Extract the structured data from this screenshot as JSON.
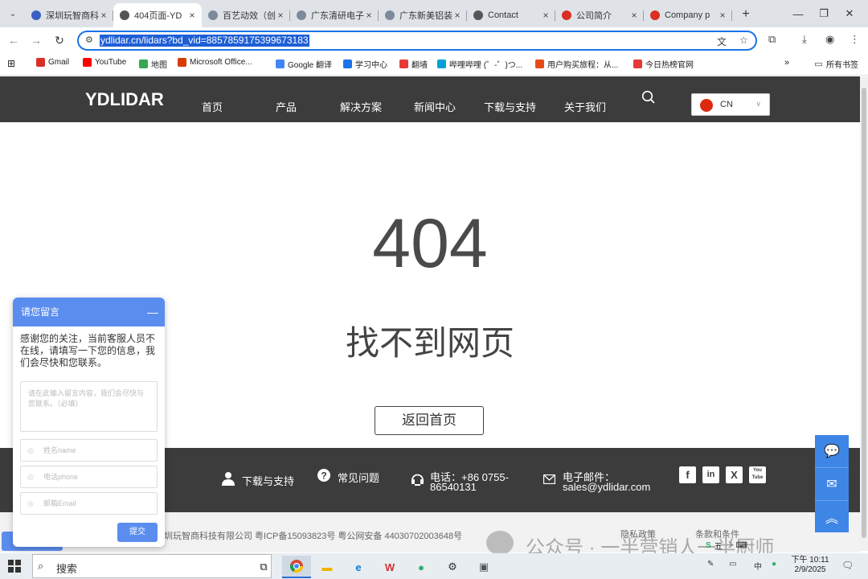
{
  "browser": {
    "tabs": [
      {
        "title": "深圳玩智商科",
        "favicon_color": "#3b5fc4",
        "active": false
      },
      {
        "title": "404页面-YD",
        "favicon_color": "#555555",
        "active": true
      },
      {
        "title": "百艺动效（创",
        "favicon_color": "#7d8a9c",
        "active": false
      },
      {
        "title": "广东清研电子",
        "favicon_color": "#7d8a9c",
        "active": false
      },
      {
        "title": "广东新美铝装",
        "favicon_color": "#7d8a9c",
        "active": false
      },
      {
        "title": "Contact",
        "favicon_color": "#555555",
        "active": false
      },
      {
        "title": "公司简介",
        "favicon_color": "#d93025",
        "active": false
      },
      {
        "title": "Company p",
        "favicon_color": "#d93025",
        "active": false
      }
    ],
    "url": "ydlidar.cn/lidars?bd_vid=8857859175399673183",
    "bookmarks": [
      {
        "label": "Gmail",
        "color": "#d93025"
      },
      {
        "label": "YouTube",
        "color": "#ff0000"
      },
      {
        "label": "地图",
        "color": "#34a853"
      },
      {
        "label": "Microsoft Office...",
        "color": "#d83b01"
      },
      {
        "label": "Google 翻译",
        "color": "#4285f4"
      },
      {
        "label": "学习中心",
        "color": "#1a73e8"
      },
      {
        "label": "翻墙",
        "color": "#e53935"
      },
      {
        "label": "哔哩哔哩 (゜-゜)つ...",
        "color": "#00a1d6"
      },
      {
        "label": "用户购买旅程：从...",
        "color": "#e64a19"
      },
      {
        "label": "今日热榜官网",
        "color": "#e53935"
      }
    ],
    "bookmarks_folder": "所有书签"
  },
  "site": {
    "logo": "YDLIDAR",
    "nav": [
      "首页",
      "产品",
      "解决方案",
      "新闻中心",
      "下载与支持",
      "关于我们"
    ],
    "lang": "CN"
  },
  "error": {
    "code": "404",
    "message": "找不到网页",
    "home_button": "返回首页"
  },
  "footer": {
    "download": "下载与支持",
    "faq": "常见问题",
    "phone_label": "电话：+86 0755-",
    "phone_number": "86540131",
    "email_label": "电子邮件：",
    "email": "sales@ydlidar.com",
    "social": [
      "f",
      "in",
      "X",
      "You Tube"
    ],
    "copyright": "圳玩智商科技有限公司 粤ICP备15093823号 粤公网安备 44030702003648号",
    "privacy": "隐私政策",
    "terms": "条款和条件",
    "watermark": "公众号 · 一半营销人一半厨师"
  },
  "chat": {
    "title": "请您留言",
    "intro": "感谢您的关注，当前客服人员不在线，请填写一下您的信息，我们会尽快和您联系。",
    "message_placeholder": "请在此输入留言内容，我们会尽快与您联系。（必填）",
    "name_placeholder": "姓名name",
    "phone_placeholder": "电话phone",
    "email_placeholder": "邮箱Email",
    "submit": "提交"
  },
  "taskbar": {
    "search": "搜索",
    "time": "下午 10:11",
    "date": "2/9/2025",
    "ime_mode": "中",
    "ime_label": "五"
  }
}
